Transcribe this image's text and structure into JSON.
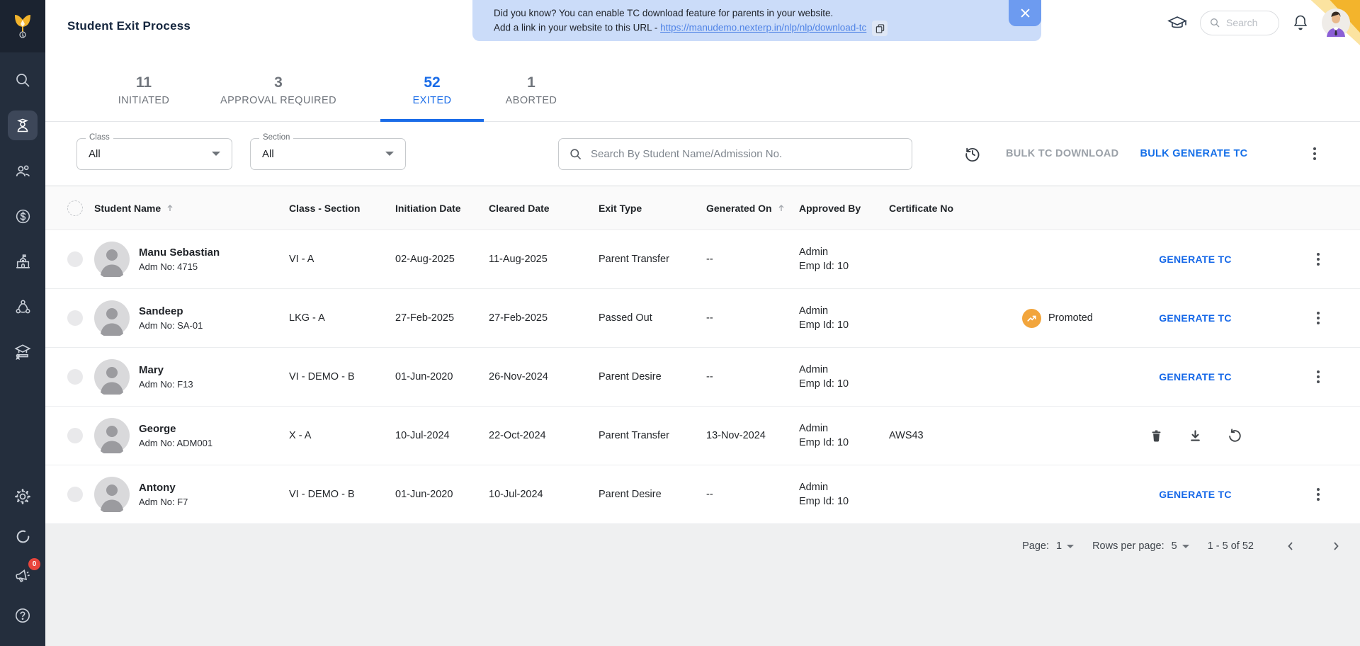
{
  "colors": {
    "accent_blue": "#1a6ce8",
    "sidebar_bg": "#242e3d",
    "banner_bg": "#cbdcf9",
    "promoted_orange": "#f2a53c",
    "alert_red": "#e8453c",
    "logo_yellow": "#f3b42c"
  },
  "sidebar": {
    "items": [
      "search",
      "students",
      "people",
      "fees",
      "school",
      "network",
      "graduation"
    ],
    "bottom_items": [
      "settings",
      "sync",
      "announcements",
      "help"
    ],
    "announcement_badge": "0"
  },
  "topbar": {
    "title": "Student Exit Process",
    "banner": {
      "line1": "Did you know? You can enable TC download feature for parents in your website.",
      "line2_prefix": "Add a link in your website to this URL - ",
      "url": "https://manudemo.nexterp.in/nlp/nlp/download-tc",
      "close_label": "✕"
    },
    "search_placeholder": "Search"
  },
  "tabs": [
    {
      "count": "11",
      "label": "INITIATED",
      "active": false
    },
    {
      "count": "3",
      "label": "APPROVAL REQUIRED",
      "active": false
    },
    {
      "count": "52",
      "label": "EXITED",
      "active": true
    },
    {
      "count": "1",
      "label": "ABORTED",
      "active": false
    }
  ],
  "filters": {
    "class": {
      "label": "Class",
      "value": "All"
    },
    "section": {
      "label": "Section",
      "value": "All"
    },
    "search_placeholder": "Search By Student Name/Admission No.",
    "bulk_tc_download": "BULK TC DOWNLOAD",
    "bulk_generate_tc": "BULK GENERATE TC"
  },
  "table": {
    "columns": [
      {
        "label": "Student Name",
        "sorted": true
      },
      {
        "label": "Class - Section",
        "sorted": false
      },
      {
        "label": "Initiation Date",
        "sorted": false
      },
      {
        "label": "Cleared Date",
        "sorted": false
      },
      {
        "label": "Exit Type",
        "sorted": false
      },
      {
        "label": "Generated On",
        "sorted": true
      },
      {
        "label": "Approved By",
        "sorted": false
      },
      {
        "label": "Certificate No",
        "sorted": false
      }
    ],
    "generate_tc_label": "GENERATE TC",
    "rows": [
      {
        "name": "Manu Sebastian",
        "adm": "Adm No: 4715",
        "class_section": "VI - A",
        "initiation_date": "02-Aug-2025",
        "cleared_date": "11-Aug-2025",
        "exit_type": "Parent Transfer",
        "generated_on": "--",
        "approved_by_1": "Admin",
        "approved_by_2": "Emp Id: 10",
        "certificate_no": "",
        "badge": "",
        "actions": "generate_tc",
        "kebab": true
      },
      {
        "name": "Sandeep",
        "adm": "Adm No: SA-01",
        "class_section": "LKG - A",
        "initiation_date": "27-Feb-2025",
        "cleared_date": "27-Feb-2025",
        "exit_type": "Passed Out",
        "generated_on": "--",
        "approved_by_1": "Admin",
        "approved_by_2": "Emp Id: 10",
        "certificate_no": "",
        "badge": "Promoted",
        "actions": "generate_tc",
        "kebab": true
      },
      {
        "name": "Mary",
        "adm": "Adm No: F13",
        "class_section": "VI - DEMO - B",
        "initiation_date": "01-Jun-2020",
        "cleared_date": "26-Nov-2024",
        "exit_type": "Parent Desire",
        "generated_on": "--",
        "approved_by_1": "Admin",
        "approved_by_2": "Emp Id: 10",
        "certificate_no": "",
        "badge": "",
        "actions": "generate_tc",
        "kebab": true
      },
      {
        "name": "George",
        "adm": "Adm No: ADM001",
        "class_section": "X - A",
        "initiation_date": "10-Jul-2024",
        "cleared_date": "22-Oct-2024",
        "exit_type": "Parent Transfer",
        "generated_on": "13-Nov-2024",
        "approved_by_1": "Admin",
        "approved_by_2": "Emp Id: 10",
        "certificate_no": "AWS43",
        "badge": "",
        "actions": "certificate_actions",
        "kebab": false
      },
      {
        "name": "Antony",
        "adm": "Adm No: F7",
        "class_section": "VI - DEMO - B",
        "initiation_date": "01-Jun-2020",
        "cleared_date": "10-Jul-2024",
        "exit_type": "Parent Desire",
        "generated_on": "--",
        "approved_by_1": "Admin",
        "approved_by_2": "Emp Id: 10",
        "certificate_no": "",
        "badge": "",
        "actions": "generate_tc",
        "kebab": true
      }
    ]
  },
  "pagination": {
    "page_label": "Page:",
    "page_value": "1",
    "rows_label": "Rows per page:",
    "rows_value": "5",
    "range": "1 - 5 of 52"
  }
}
